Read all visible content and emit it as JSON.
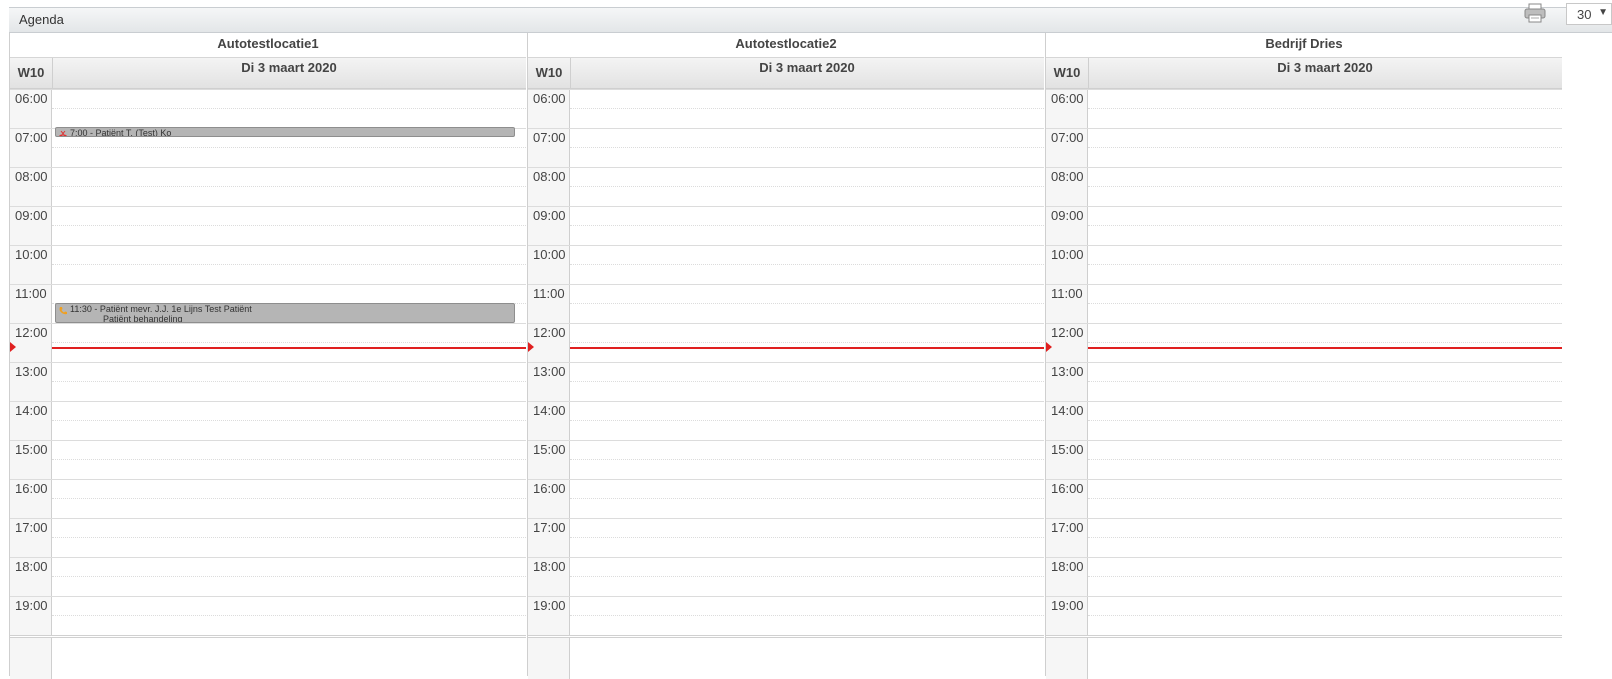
{
  "header": {
    "title": "Agenda",
    "print_icon": "printer-icon",
    "interval_value": "30"
  },
  "columns": [
    {
      "location": "Autotestlocatie1",
      "week": "W10",
      "date": "Di 3 maart 2020",
      "appointments": [
        {
          "text": "7:00 - Patiënt T. (Test) Ko",
          "icon": "scissors-icon",
          "icon_color": "#e03030"
        },
        {
          "text": "11:30 - Patiënt mevr. J.J. 1e Lijns Test Patiënt",
          "sub": "Patiënt behandeling",
          "icon": "phone-icon",
          "icon_color": "#f0a020"
        }
      ]
    },
    {
      "location": "Autotestlocatie2",
      "week": "W10",
      "date": "Di 3 maart 2020",
      "appointments": []
    },
    {
      "location": "Bedrijf Dries",
      "week": "W10",
      "date": "Di 3 maart 2020",
      "appointments": []
    }
  ],
  "hours": [
    "06:00",
    "07:00",
    "08:00",
    "09:00",
    "10:00",
    "11:00",
    "12:00",
    "13:00",
    "14:00",
    "15:00",
    "16:00",
    "17:00",
    "18:00",
    "19:00"
  ],
  "colors": {
    "now_line": "#e02020",
    "appointment_bg": "#b5b5b5"
  }
}
